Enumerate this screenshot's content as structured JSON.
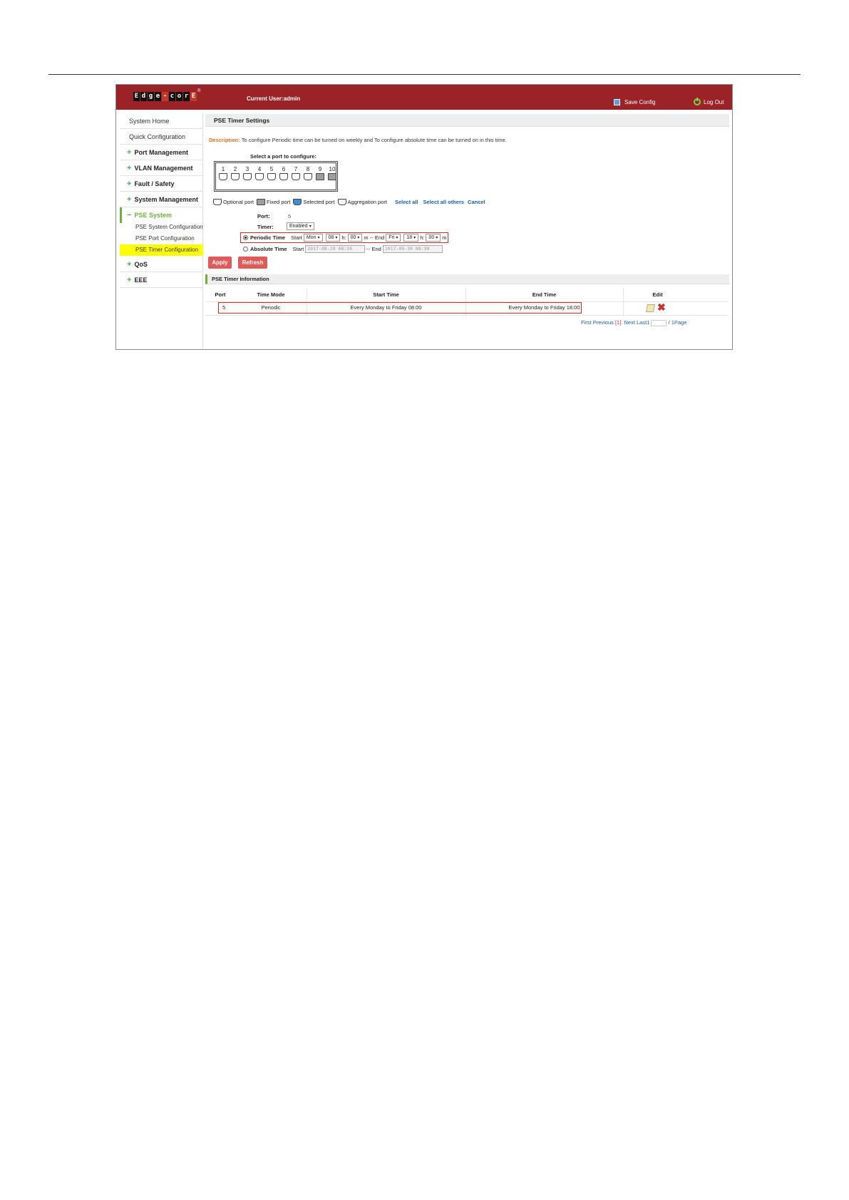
{
  "header": {
    "logo_letters": [
      "E",
      "d",
      "g",
      "e",
      "-",
      "c",
      "o",
      "r",
      "E"
    ],
    "logo_reg": "®",
    "current_user": "Current User:admin",
    "save_config": "Save Config",
    "log_out": "Log Out"
  },
  "sidebar": {
    "items": [
      {
        "label": "System Home"
      },
      {
        "label": "Quick Configuration"
      },
      {
        "label": "Port Management"
      },
      {
        "label": "VLAN Management"
      },
      {
        "label": "Fault / Safety"
      },
      {
        "label": "System Management"
      },
      {
        "label": "PSE System"
      },
      {
        "label": "QoS"
      },
      {
        "label": "EEE"
      }
    ],
    "plus": "+",
    "minus": "−",
    "sub_items": [
      {
        "label": "PSE System Configuration"
      },
      {
        "label": "PSE Port Configuration"
      },
      {
        "label": "PSE Timer Configuration"
      }
    ]
  },
  "main": {
    "section_title": "PSE Timer Settings",
    "description_label": "Description:",
    "description_text": "To configure Periodic time can be turned on weekly and To configure absolute time can be turned on in this time.",
    "select_port_title": "Select a port to configure:",
    "ports": [
      "1",
      "2",
      "3",
      "4",
      "5",
      "6",
      "7",
      "8",
      "9",
      "10"
    ],
    "legend": {
      "optional": "Optional port",
      "fixed": "Fixed port",
      "selected": "Selected port",
      "aggregation": "Aggregation port",
      "select_all": "Select all",
      "select_all_others": "Select all others",
      "cancel": "Cancel"
    },
    "form": {
      "port_label": "Port:",
      "port_value": "5",
      "timer_label": "Timer:",
      "timer_value": "Enabled",
      "periodic_label": "Periodic Time",
      "start_label": "Start",
      "periodic_start_day": "Mon",
      "periodic_start_hour": "08",
      "h": "h:",
      "periodic_start_min": "00",
      "m_dash_end": "m -- End",
      "periodic_end_day": "Fri",
      "periodic_end_hour": "18",
      "periodic_end_min": "00",
      "m": "m",
      "absolute_label": "Absolute Time",
      "absolute_start": "2017-08-29 08:30",
      "dash_end": "-- End",
      "absolute_end": "2017-09-30 08:30",
      "caret": "▾"
    },
    "buttons": {
      "apply": "Apply",
      "refresh": "Refresh"
    },
    "info_title": "PSE Timer Information",
    "table": {
      "headers": [
        "Port",
        "Time Mode",
        "Start Time",
        "End Time",
        "Edit"
      ],
      "rows": [
        {
          "port": "5",
          "mode": "Periodic",
          "start": "Every Monday to Friday 08:00",
          "end": "Every Monday to Friday 18:00"
        }
      ]
    },
    "pager": {
      "first": "First",
      "previous": "Previous",
      "current": "[1]",
      "next": "Next",
      "last": "Last",
      "page_input": "1",
      "total": "/ 1Page"
    }
  }
}
